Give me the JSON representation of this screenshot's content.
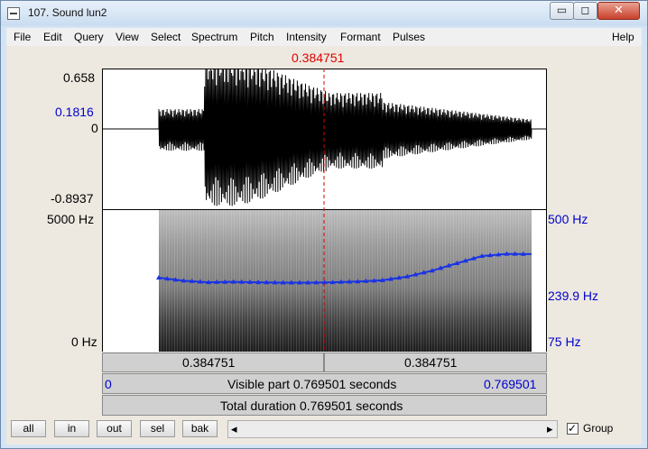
{
  "window": {
    "title": "107. Sound lun2",
    "minimize_glyph": "▭",
    "maximize_glyph": "◻",
    "close_glyph": "✕"
  },
  "menu": {
    "items": [
      "File",
      "Edit",
      "Query",
      "View",
      "Select",
      "Spectrum",
      "Pitch",
      "Intensity",
      "Formant",
      "Pulses"
    ],
    "help": "Help"
  },
  "cursor": {
    "time_label": "0.384751",
    "time": 0.384751
  },
  "waveform": {
    "y_max": "0.658",
    "y_cursor": "0.1816",
    "y_zero": "0",
    "y_min": "-0.8937"
  },
  "spectrogram": {
    "freq_max": "5000 Hz",
    "freq_min": "0 Hz",
    "pitch_max": "500 Hz",
    "pitch_cursor": "239.9 Hz",
    "pitch_min": "75 Hz"
  },
  "time_bars": {
    "left_segment": "0.384751",
    "right_segment": "0.384751",
    "visible_start": "0",
    "visible_text": "Visible part 0.769501 seconds",
    "visible_end": "0.769501",
    "total_text": "Total duration 0.769501 seconds"
  },
  "buttons": {
    "all": "all",
    "in": "in",
    "out": "out",
    "sel": "sel",
    "bak": "bak"
  },
  "scrollbar": {
    "left_arrow": "◂",
    "right_arrow": "▸"
  },
  "group": {
    "label": "Group",
    "checked": true,
    "check_glyph": "✓"
  },
  "colors": {
    "cursor": "#e00000",
    "axis_blue": "#0000cc",
    "pitch": "#1a33e6"
  },
  "chart_data": {
    "type": "line",
    "series": [
      {
        "name": "pitch",
        "x": [
          0.0,
          0.05,
          0.1,
          0.15,
          0.2,
          0.25,
          0.3,
          0.35,
          0.4,
          0.45,
          0.5,
          0.55,
          0.6,
          0.65,
          0.7,
          0.75
        ],
        "values": [
          202,
          194,
          190,
          191,
          190,
          189,
          189,
          190,
          192,
          195,
          205,
          222,
          245,
          270,
          278,
          277
        ]
      }
    ],
    "xlim": [
      0,
      0.769501
    ],
    "ylim": [
      75,
      500
    ]
  }
}
